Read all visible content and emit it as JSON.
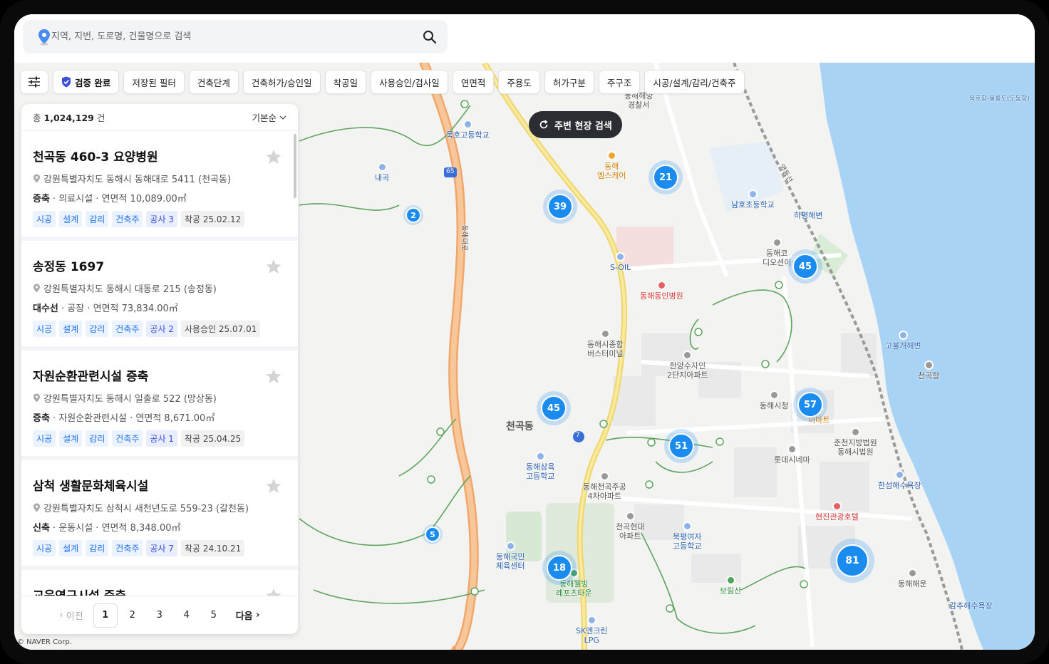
{
  "search": {
    "placeholder": "지역, 지번, 도로명, 건물명으로 검색"
  },
  "filters": {
    "verified": "검증 완료",
    "chips": [
      "저장된 필터",
      "건축단계",
      "건축허가/승인일",
      "착공일",
      "사용승인/검사일",
      "연면적",
      "주용도",
      "허가구분",
      "주구조",
      "시공/설계/감리/건축주"
    ]
  },
  "panel": {
    "total_prefix": "총",
    "total_count": "1,024,129",
    "total_suffix": "건",
    "sort_label": "기본순",
    "items": [
      {
        "title": "천곡동 460-3 요양병원",
        "address": "강원특별자치도 동해시 동해대로 5411 (천곡동)",
        "kind": "증축",
        "use": "의료시설",
        "area": "연면적 10,089.00㎡",
        "tags": [
          "시공",
          "설계",
          "감리",
          "건축주"
        ],
        "phase": "공사 3",
        "date": "착공 25.02.12"
      },
      {
        "title": "송정동 1697",
        "address": "강원특별자치도 동해시 대동로 215 (송정동)",
        "kind": "대수선",
        "use": "공장",
        "area": "연면적 73,834.00㎡",
        "tags": [
          "시공",
          "설계",
          "감리",
          "건축주"
        ],
        "phase": "공사 2",
        "date": "사용승인 25.07.01"
      },
      {
        "title": "자원순환관련시설 증축",
        "address": "강원특별자치도 동해시 일출로 522 (망상동)",
        "kind": "증축",
        "use": "자원순환관련시설",
        "area": "연면적 8,671.00㎡",
        "tags": [
          "시공",
          "설계",
          "감리",
          "건축주"
        ],
        "phase": "공사 1",
        "date": "착공 25.04.25"
      },
      {
        "title": "삼척 생활문화체육시설",
        "address": "강원특별자치도 삼척시 새천년도로 559-23 (갈천동)",
        "kind": "신축",
        "use": "운동시설",
        "area": "연면적 8,348.00㎡",
        "tags": [
          "시공",
          "설계",
          "감리",
          "건축주"
        ],
        "phase": "공사 7",
        "date": "착공 24.10.21"
      },
      {
        "title": "교육연구시설 증축"
      }
    ],
    "pager": {
      "prev": "이전",
      "pages": [
        "1",
        "2",
        "3",
        "4",
        "5"
      ],
      "next": "다음"
    }
  },
  "map": {
    "nearby_button": "주변 현장 검색",
    "district": "천곡동",
    "clusters": [
      "2",
      "39",
      "21",
      "45",
      "45",
      "57",
      "51",
      "5",
      "18",
      "81"
    ],
    "pois": [
      "묵호고등학교",
      "내곡",
      "동해\n엠스케어",
      "동해해양\n경찰서",
      "남호초등학교",
      "하평해변",
      "S-OIL",
      "동해동인병원",
      "동해코\n디오션이",
      "동해시종합\n버스터미널",
      "한양수자인\n2단지아파트",
      "고불개해변",
      "천곡항",
      "동해시청",
      "이마트",
      "춘천지방법원\n동해시법원",
      "롯데시네마",
      "동해삼육\n고등학교",
      "동해천곡주공\n4차아파트",
      "천곡현대\n아파트",
      "북평여자\n고등학교",
      "한섬해수욕장",
      "현진관광호텔",
      "동해국민\n체육센터",
      "동해웰빙\n레포츠타운",
      "보림산",
      "동해해운",
      "감추해수욕장",
      "SK엔크린\nLPG"
    ],
    "road_labels": [
      "65",
      "7",
      "동해대로",
      "영동선",
      "묵호항-울릉도(도동항)"
    ],
    "copyright": "© NAVER Corp."
  },
  "colors": {
    "accent": "#1a8cf0",
    "sea": "#a8d3f5",
    "dark_button": "#2a2e33"
  }
}
